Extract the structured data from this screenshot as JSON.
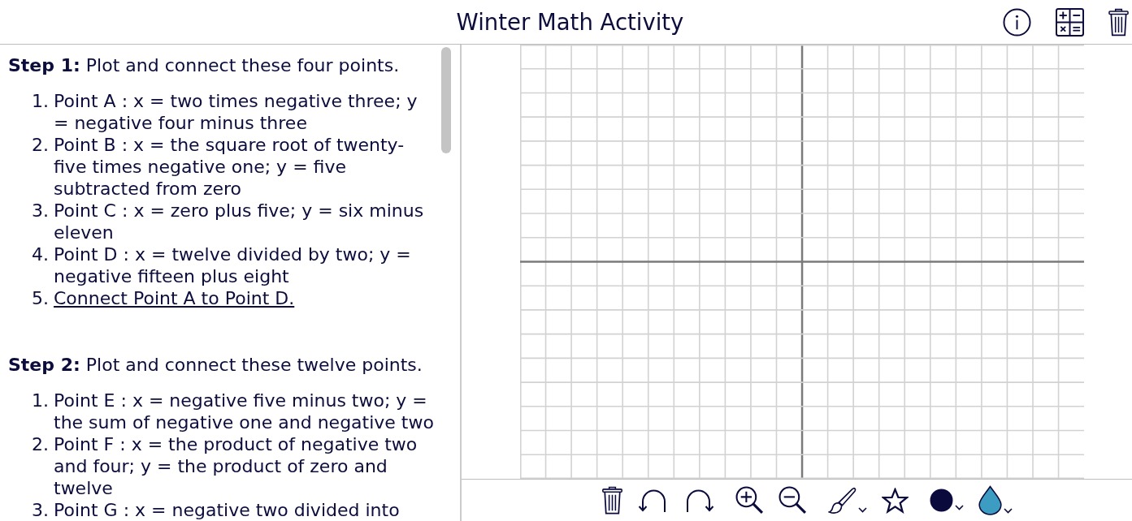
{
  "header": {
    "title": "Winter Math Activity"
  },
  "instructions": [
    {
      "heading": "**Step 1:** Plot and connect these four points.",
      "items": [
        {
          "number": "1.",
          "text": "Point A : x = two times negative three; y = negative four minus three",
          "link": false
        },
        {
          "number": "2.",
          "text": "Point B : x = the square root of twenty-five times negative one; y = five subtracted from zero",
          "link": false
        },
        {
          "number": "3.",
          "text": "Point C : x = zero plus five; y = six minus eleven",
          "link": false
        },
        {
          "number": "4.",
          "text": "Point D : x = twelve divided by two; y = negative fifteen plus eight",
          "link": false
        },
        {
          "number": "5.",
          "text": "Connect Point A to Point D.",
          "link": true
        }
      ]
    },
    {
      "heading": "**Step 2:** Plot and connect these twelve points.",
      "items": [
        {
          "number": "1.",
          "text": "Point E : x = negative five minus two; y = the sum of negative one and negative two",
          "link": false
        },
        {
          "number": "2.",
          "text": "Point F : x = the product of negative two and four; y = the product of zero and twelve",
          "link": false
        },
        {
          "number": "3.",
          "text": "Point G : x = negative two divided into",
          "link": false
        }
      ]
    }
  ],
  "color_tools": [
    {
      "kind": "stroke",
      "color": "#0a0a3c"
    },
    {
      "kind": "fill",
      "color": "#3d9cc1"
    }
  ]
}
